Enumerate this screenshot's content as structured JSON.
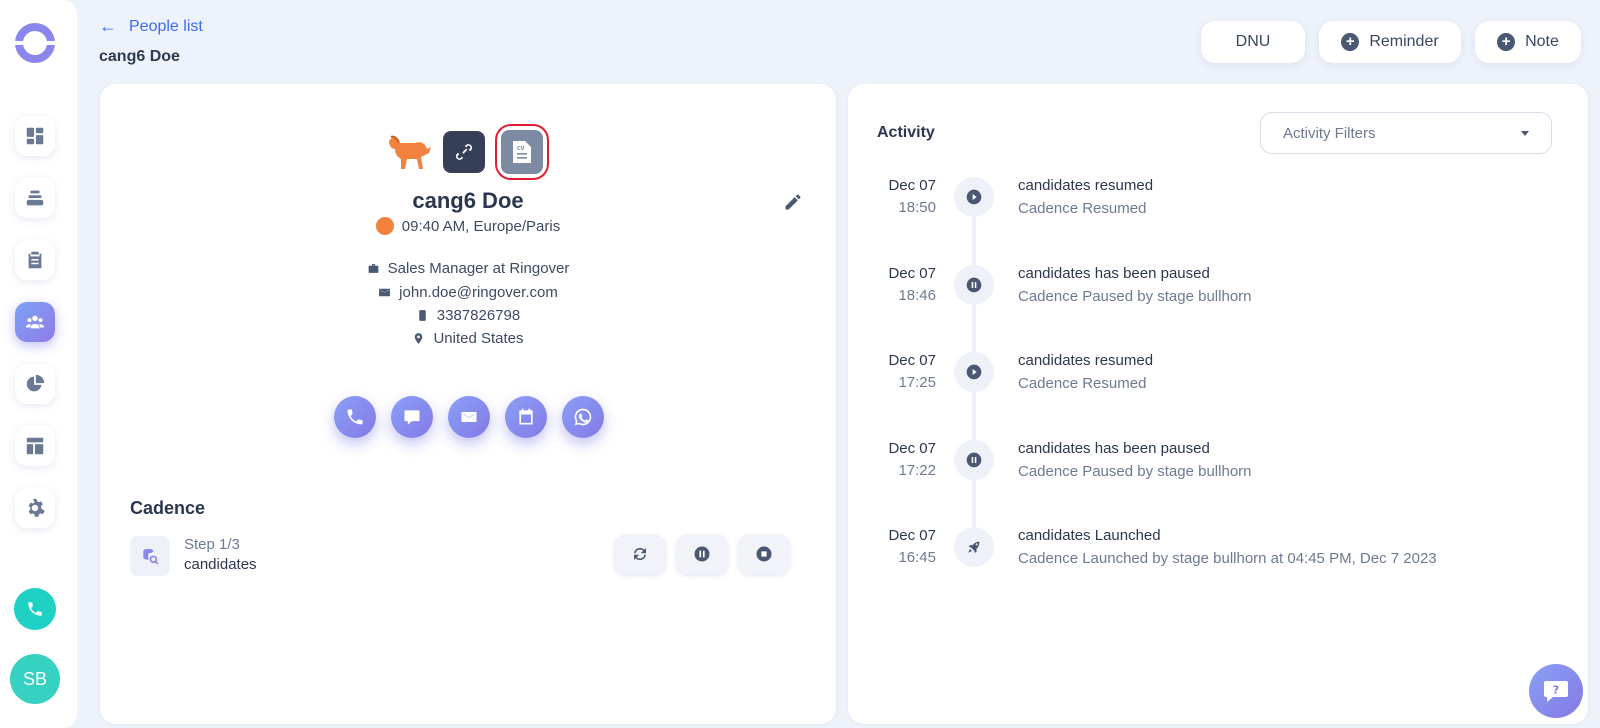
{
  "header": {
    "back_label": "People list",
    "person_name": "cang6 Doe",
    "buttons": {
      "dnu": "DNU",
      "reminder": "Reminder",
      "note": "Note"
    }
  },
  "sidebar": {
    "items": [
      "dashboard-icon",
      "layers-icon",
      "clipboard-icon",
      "people-icon",
      "pie-chart-icon",
      "layout-icon",
      "gear-icon"
    ],
    "active": "people-icon",
    "avatar_initials": "SB"
  },
  "profile": {
    "name": "cang6 Doe",
    "timezone": "09:40 AM, Europe/Paris",
    "job": "Sales Manager at Ringover",
    "email": "john.doe@ringover.com",
    "phone": "3387826798",
    "location": "United States",
    "actions": [
      "phone-icon",
      "chat-icon",
      "mail-icon",
      "calendar-icon",
      "whatsapp-icon"
    ]
  },
  "cadence": {
    "title": "Cadence",
    "step_label": "Step 1/3",
    "step_name": "candidates"
  },
  "activity": {
    "title": "Activity",
    "filter_label": "Activity Filters",
    "events": [
      {
        "date": "Dec 07",
        "time": "18:50",
        "title": "candidates resumed",
        "desc": "Cadence Resumed",
        "icon": "play"
      },
      {
        "date": "Dec 07",
        "time": "18:46",
        "title": "candidates has been paused",
        "desc": "Cadence Paused by stage bullhorn",
        "icon": "pause"
      },
      {
        "date": "Dec 07",
        "time": "17:25",
        "title": "candidates resumed",
        "desc": "Cadence Resumed",
        "icon": "play"
      },
      {
        "date": "Dec 07",
        "time": "17:22",
        "title": "candidates has been paused",
        "desc": "Cadence Paused by stage bullhorn",
        "icon": "pause"
      },
      {
        "date": "Dec 07",
        "time": "16:45",
        "title": "candidates Launched",
        "desc": "Cadence Launched by stage bullhorn at 04:45 PM, Dec 7 2023",
        "icon": "rocket"
      }
    ]
  },
  "colors": {
    "accent": "#3d6bf2",
    "purple": "#8479e6",
    "teal": "#1fd1c4",
    "orange": "#f4823f"
  }
}
